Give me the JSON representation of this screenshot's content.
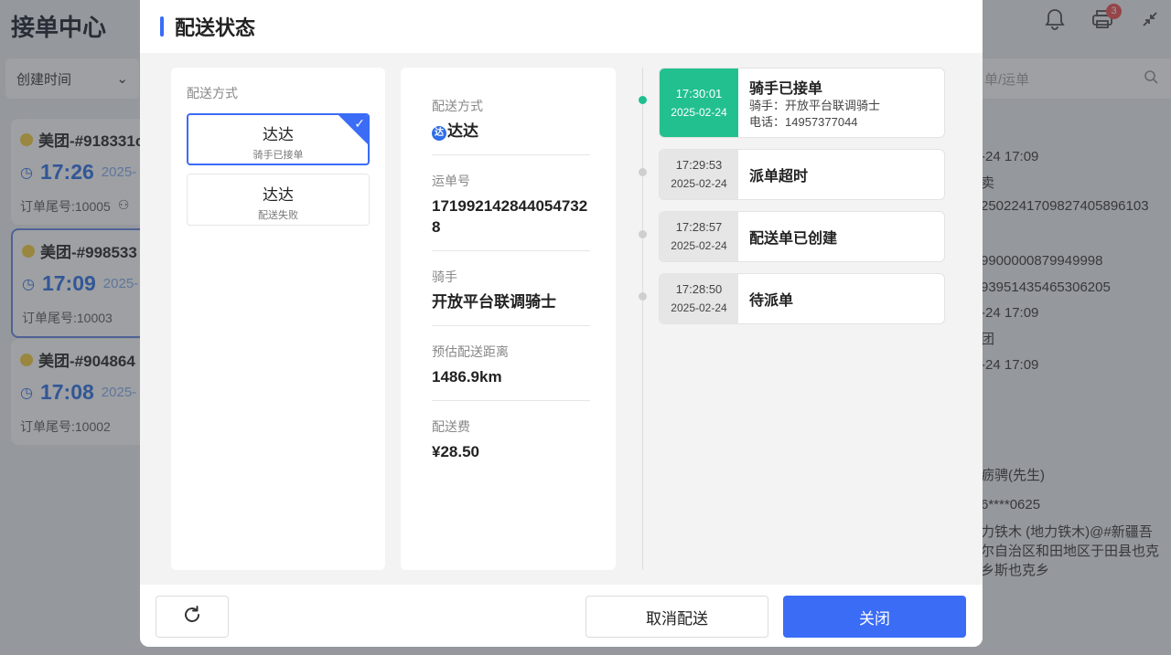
{
  "background": {
    "app_title": "接单中心",
    "notification_badge": "3",
    "filter_label": "创建时间",
    "search_placeholder": "单/运单",
    "orders": [
      {
        "title": "美团-#918331c",
        "time": "17:26",
        "date": "2025-",
        "tail": "订单尾号:10005"
      },
      {
        "title": "美团-#998533",
        "time": "17:09",
        "date": "2025-",
        "tail": "订单尾号:10003"
      },
      {
        "title": "美团-#904864",
        "time": "17:08",
        "date": "2025-",
        "tail": "订单尾号:10002"
      }
    ],
    "detail_lines": [
      "-24 17:09",
      "卖",
      "2502241709827405896103",
      "9900000879949998",
      "93951435465306205",
      "-24 17:09",
      "团",
      "-24 17:09"
    ],
    "customer_name": "疬骋(先生)",
    "customer_phone": "6****0625",
    "customer_address": "力铁木 (地力铁木)@#新疆吾尔自治区和田地区于田县也克乡斯也克乡"
  },
  "modal": {
    "title": "配送状态",
    "left_panel": {
      "label": "配送方式",
      "options": [
        {
          "name": "达达",
          "sub": "骑手已接单",
          "selected": true
        },
        {
          "name": "达达",
          "sub": "配送失败",
          "selected": false
        }
      ]
    },
    "details": {
      "method_label": "配送方式",
      "method_value": "达达",
      "waybill_label": "运单号",
      "waybill_value": "1719921428440547328",
      "rider_label": "骑手",
      "rider_value": "开放平台联调骑士",
      "distance_label": "预估配送距离",
      "distance_value": "1486.9km",
      "fee_label": "配送费",
      "fee_value": "¥28.50"
    },
    "timeline": [
      {
        "time": "17:30:01",
        "date": "2025-02-24",
        "status": "骑手已接单",
        "rider": "骑手：开放平台联调骑士",
        "phone": "电话：14957377044"
      },
      {
        "time": "17:29:53",
        "date": "2025-02-24",
        "status": "派单超时"
      },
      {
        "time": "17:28:57",
        "date": "2025-02-24",
        "status": "配送单已创建"
      },
      {
        "time": "17:28:50",
        "date": "2025-02-24",
        "status": "待派单"
      }
    ],
    "footer": {
      "cancel_label": "取消配送",
      "close_label": "关闭"
    }
  },
  "colors": {
    "primary": "#3b6cf6",
    "success": "#22c08f",
    "badge": "#f05a5a"
  }
}
